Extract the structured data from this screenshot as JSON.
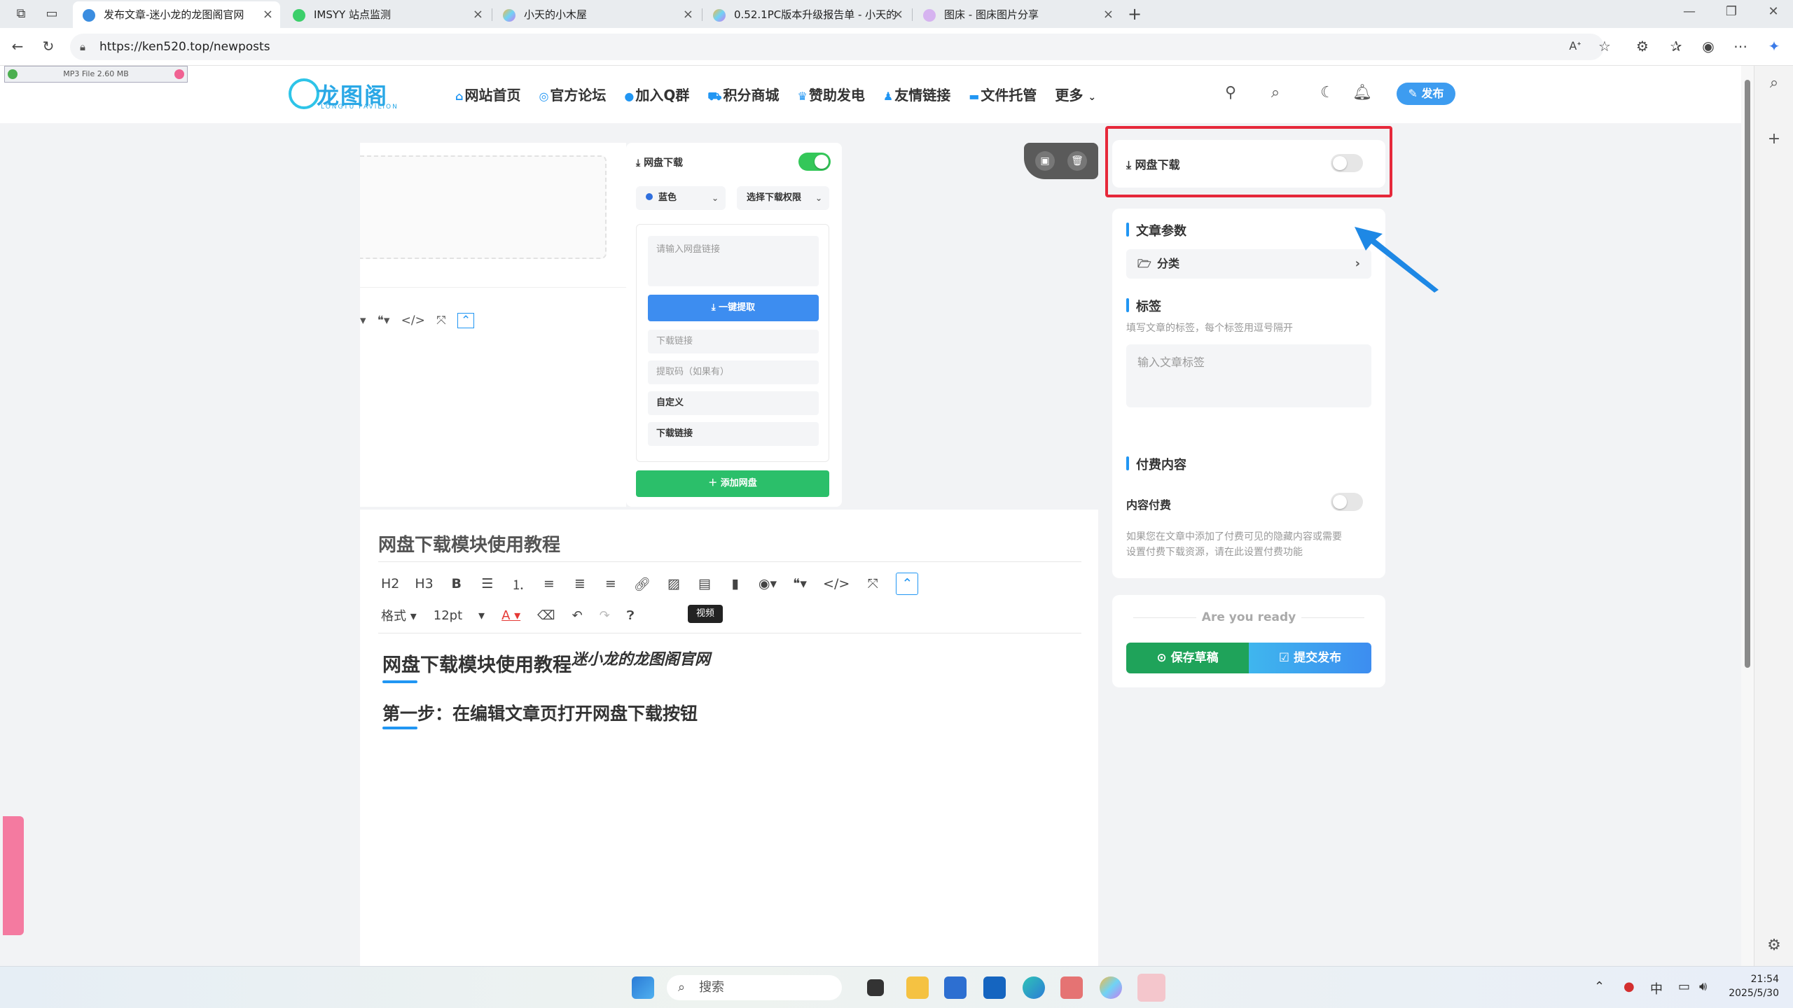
{
  "browser": {
    "tabs": [
      {
        "title": "发布文章-迷小龙的龙图阁官网",
        "active": true
      },
      {
        "title": "IMSYY 站点监测",
        "active": false
      },
      {
        "title": "小天的小木屋",
        "active": false
      },
      {
        "title": "0.52.1PC版本升级报告单 - 小天的",
        "active": false
      },
      {
        "title": "图床 - 图床图片分享",
        "active": false
      }
    ],
    "url": "https://ken520.top/newposts"
  },
  "mp3": {
    "label": "MP3 File 2.60 MB"
  },
  "site": {
    "logo_name": "龙图阁",
    "logo_sub": "LONGTU PAVILION",
    "nav": [
      "网站首页",
      "官方论坛",
      "加入Q群",
      "积分商城",
      "赞助发电",
      "友情链接",
      "文件托管",
      "更多"
    ],
    "publish": "发布"
  },
  "netdisk_panel": {
    "title": "网盘下载",
    "color_select": "蓝色",
    "permission_select": "选择下载权限",
    "link_placeholder": "请输入网盘链接",
    "extract_btn": "一键提取",
    "field_download": "下载链接",
    "field_code": "提取码（如果有）",
    "field_custom": "自定义",
    "field_download2": "下载链接",
    "add_btn": "添加网盘"
  },
  "editor": {
    "title": "网盘下载模块使用教程",
    "tools": [
      "H2",
      "H3",
      "B"
    ],
    "format": "格式",
    "font_size": "12pt",
    "tooltip": "视频",
    "h1": "网盘下载模块使用教程",
    "h1_tail": "迷小龙的龙图阁官网",
    "h2": "第一步：在编辑文章页打开网盘下载按钮"
  },
  "sidebar": {
    "netdisk_label": "网盘下载",
    "params_title": "文章参数",
    "category": "分类",
    "tags_title": "标签",
    "tags_hint": "填写文章的标签，每个标签用逗号隔开",
    "tags_placeholder": "输入文章标签",
    "paid_title": "付费内容",
    "paid_label": "内容付费",
    "paid_hint_1": "如果您在文章中添加了付费可见的隐藏内容或需要",
    "paid_hint_2": "设置付费下载资源，请在此设置付费功能",
    "ready": "Are you ready",
    "save": "保存草稿",
    "submit": "提交发布"
  },
  "taskbar": {
    "search": "搜索",
    "ime": "中",
    "time": "21:54",
    "date": "2025/5/30"
  },
  "colors": {
    "accent": "#2196f3",
    "highlight": "#e6283a",
    "green": "#1fa35a"
  }
}
